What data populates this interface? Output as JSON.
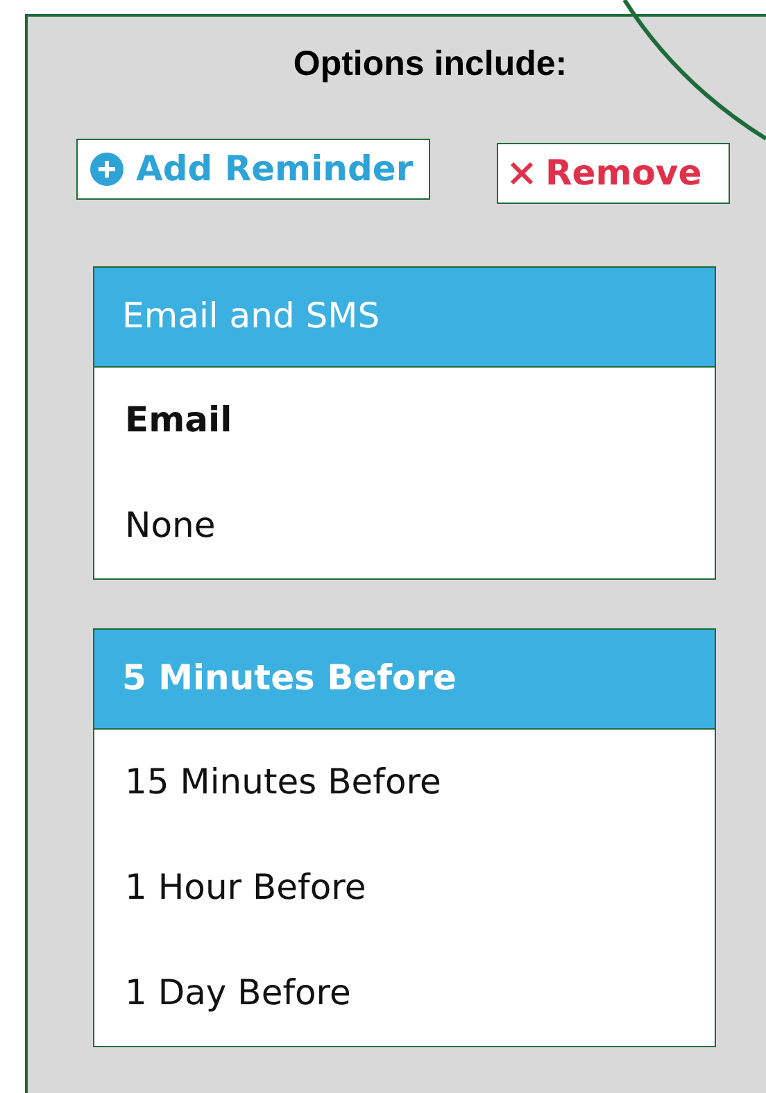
{
  "heading": "Options include:",
  "buttons": [
    {
      "kind": "add",
      "label": "Add Reminder"
    },
    {
      "kind": "remove",
      "label": "Remove"
    }
  ],
  "dropdowns": [
    {
      "value": "Email and SMS",
      "value_bold": false,
      "options": [
        {
          "label": "Email",
          "selected": true
        },
        {
          "label": "None",
          "selected": false
        }
      ]
    },
    {
      "value": "5 Minutes Before",
      "value_bold": true,
      "options": [
        {
          "label": "15 Minutes Before",
          "selected": false
        },
        {
          "label": "1 Hour Before",
          "selected": false
        },
        {
          "label": "1 Day Before",
          "selected": false
        }
      ]
    }
  ]
}
